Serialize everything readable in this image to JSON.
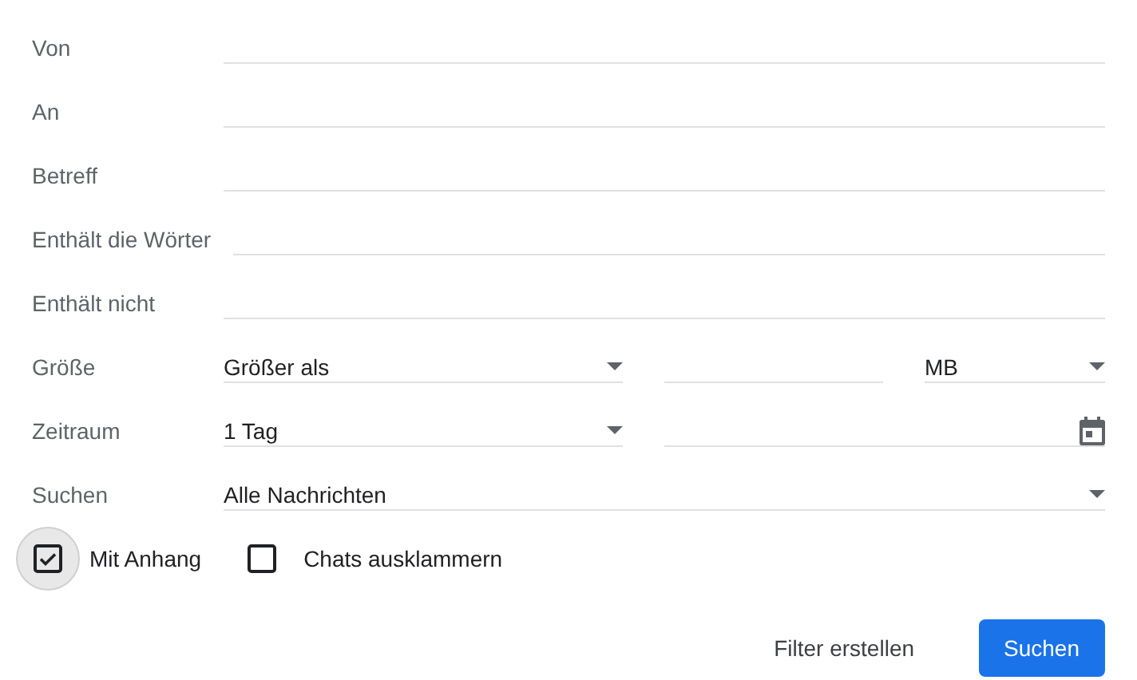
{
  "rows": [
    {
      "kind": "text",
      "label": "Von"
    },
    {
      "kind": "text",
      "label": "An"
    },
    {
      "kind": "text",
      "label": "Betreff"
    },
    {
      "kind": "text",
      "label": "Enthält die Wörter"
    },
    {
      "kind": "text",
      "label": "Enthält nicht"
    },
    {
      "kind": "size",
      "label": "Größe",
      "operator": "Größer als",
      "unit": "MB"
    },
    {
      "kind": "date",
      "label": "Zeitraum",
      "range": "1 Tag"
    },
    {
      "kind": "select",
      "label": "Suchen",
      "value": "Alle Nachrichten"
    }
  ],
  "options": [
    {
      "label": "Mit Anhang",
      "checked": true,
      "focused": true
    },
    {
      "label": "Chats ausklammern",
      "checked": false,
      "focused": false
    }
  ],
  "buttons": [
    {
      "label": "Filter erstellen",
      "kind": "text"
    },
    {
      "label": "Suchen",
      "kind": "primary"
    }
  ]
}
